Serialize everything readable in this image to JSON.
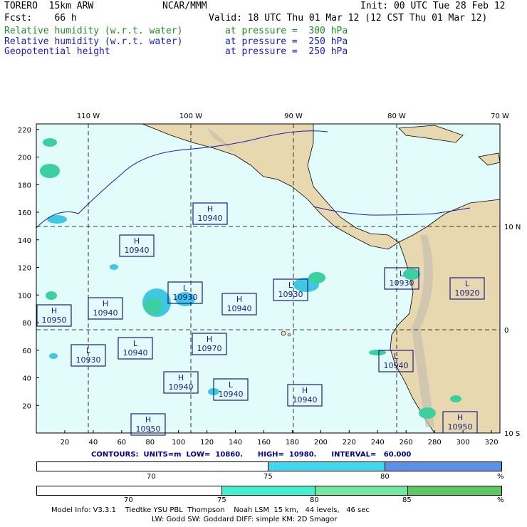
{
  "header": {
    "model": "TORERO  15km ARW",
    "center": "NCAR/MMM",
    "init": "Init: 00 UTC Tue 28 Feb 12",
    "fcst": "Fcst:    66 h",
    "valid": "Valid: 18 UTC Thu 01 Mar 12 (12 CST Thu 01 Mar 12)"
  },
  "fields": [
    {
      "name": "Relative humidity (w.r.t. water)",
      "level": "at pressure =  300 hPa",
      "color": "#228b22"
    },
    {
      "name": "Relative humidity (w.r.t. water)",
      "level": "at pressure =  250 hPa",
      "color": "#1c1cb4"
    },
    {
      "name": "Geopotential height",
      "level": "at pressure =  250 hPa",
      "color": "#1c1cb4"
    }
  ],
  "map": {
    "lon_labels": [
      "110 W",
      "100 W",
      "90 W",
      "80 W",
      "70 W"
    ],
    "lat_labels": [
      "10 N",
      "0",
      "10 S"
    ],
    "x_ticks": [
      "20",
      "40",
      "60",
      "80",
      "100",
      "120",
      "140",
      "160",
      "180",
      "200",
      "220",
      "240",
      "260",
      "280",
      "300",
      "320"
    ],
    "y_ticks": [
      "220",
      "200",
      "180",
      "160",
      "140",
      "120",
      "100",
      "80",
      "60",
      "40",
      "20"
    ],
    "colors": {
      "ocean": "#e2fbfb",
      "land": "#e8d8b0",
      "rh_green": "#3cd0a0",
      "rh_blue": "#40c8e0"
    },
    "highs_lows": [
      {
        "type": "H",
        "value": "10940"
      },
      {
        "type": "H",
        "value": "10940"
      },
      {
        "type": "L",
        "value": "10930"
      },
      {
        "type": "H",
        "value": "10940"
      },
      {
        "type": "L",
        "value": "10930"
      },
      {
        "type": "L",
        "value": "10930"
      },
      {
        "type": "L",
        "value": "10920"
      },
      {
        "type": "H",
        "value": "10950"
      },
      {
        "type": "H",
        "value": "10940"
      },
      {
        "type": "L",
        "value": "10940"
      },
      {
        "type": "H",
        "value": "10970"
      },
      {
        "type": "L",
        "value": "10930"
      },
      {
        "type": "L",
        "value": "10940"
      },
      {
        "type": "H",
        "value": "10940"
      },
      {
        "type": "L",
        "value": "10940"
      },
      {
        "type": "H",
        "value": "10940"
      },
      {
        "type": "H",
        "value": "10950"
      },
      {
        "type": "H",
        "value": "10950"
      }
    ]
  },
  "contours": "CONTOURS:  UNITS=m  LOW=  10860.      HIGH=  10980.      INTERVAL=   60.000",
  "colorbar1": {
    "labels": [
      "70",
      "75",
      "80",
      "%"
    ],
    "colors": [
      "#ffffff",
      "#40d8f0",
      "#5a90e8"
    ]
  },
  "colorbar2": {
    "labels": [
      "70",
      "75",
      "80",
      "85",
      "%"
    ],
    "colors": [
      "#ffffff",
      "#40f0d0",
      "#70e8a0",
      "#5cc860"
    ]
  },
  "footer": {
    "line1": "Model Info: V3.3.1    Tiedtke YSU PBL  Thompson    Noah LSM  15 km,   44 levels,   46 sec",
    "line2": "LW: Godd SW: Goddard DIFF: simple KM: 2D Smagor"
  }
}
